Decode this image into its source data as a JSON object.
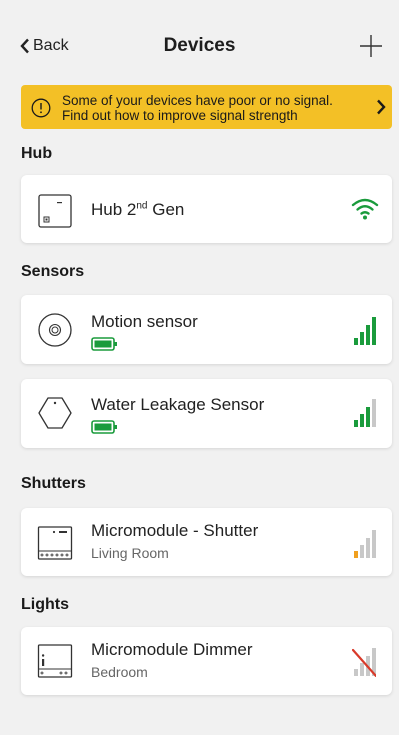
{
  "header": {
    "back_label": "Back",
    "title": "Devices"
  },
  "banner": {
    "line1": "Some of your devices have poor or no signal.",
    "line2": "Find out how to improve signal strength",
    "color": "#f3c026"
  },
  "sections": {
    "hub": "Hub",
    "sensors": "Sensors",
    "shutters": "Shutters",
    "lights": "Lights"
  },
  "devices": {
    "hub": {
      "name": "Hub 2",
      "name_sup": "nd",
      "name_suffix": " Gen",
      "icon": "hub-icon",
      "signal": "wifi-strong"
    },
    "motion": {
      "name": "Motion sensor",
      "icon": "motion-sensor-icon",
      "battery": "full",
      "signal_bars": 4
    },
    "water": {
      "name": "Water Leakage Sensor",
      "icon": "water-sensor-icon",
      "battery": "full",
      "signal_bars": 3
    },
    "shutter": {
      "name": "Micromodule - Shutter",
      "room": "Living Room",
      "icon": "micromodule-shutter-icon",
      "signal_bars": 1
    },
    "dimmer": {
      "name": "Micromodule Dimmer",
      "room": "Bedroom",
      "icon": "micromodule-dimmer-icon",
      "signal_bars": 0
    }
  },
  "colors": {
    "signal_good": "#1a9b3c",
    "signal_weak": "#f0a020",
    "signal_none": "#d83a2a",
    "signal_empty": "#c8c8c8"
  }
}
